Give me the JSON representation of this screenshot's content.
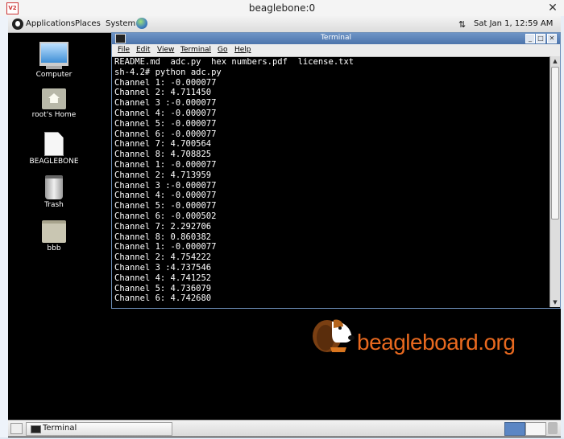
{
  "vnc": {
    "title": "beaglebone:0",
    "logo_text": "V2",
    "close_glyph": "✕"
  },
  "top_panel": {
    "applications": "Applications",
    "places": "Places",
    "system": "System",
    "network_glyph": "⇅",
    "clock": "Sat Jan  1, 12:59 AM"
  },
  "desktop_icons": [
    {
      "label": "Computer",
      "icon": "computer-icon"
    },
    {
      "label": "root's Home",
      "icon": "home-folder-icon"
    },
    {
      "label": "BEAGLEBONE",
      "icon": "file-icon"
    },
    {
      "label": "Trash",
      "icon": "trash-icon"
    },
    {
      "label": "bbb",
      "icon": "folder-icon"
    }
  ],
  "terminal": {
    "title": "Terminal",
    "buttons": {
      "minimize": "_",
      "maximize": "□",
      "close": "✕"
    },
    "menu": [
      "File",
      "Edit",
      "View",
      "Terminal",
      "Go",
      "Help"
    ],
    "lines": [
      "README.md  adc.py  hex numbers.pdf  license.txt",
      "sh-4.2# python adc.py",
      "Channel 1: -0.000077",
      "Channel 2: 4.711450",
      "Channel 3 :-0.000077",
      "Channel 4: -0.000077",
      "Channel 5: -0.000077",
      "Channel 6: -0.000077",
      "Channel 7: 4.700564",
      "Channel 8: 4.708825",
      "Channel 1: -0.000077",
      "Channel 2: 4.713959",
      "Channel 3 :-0.000077",
      "Channel 4: -0.000077",
      "Channel 5: -0.000077",
      "Channel 6: -0.000502",
      "Channel 7: 2.292706",
      "Channel 8: 0.860382",
      "Channel 1: -0.000077",
      "Channel 2: 4.754222",
      "Channel 3 :4.737546",
      "Channel 4: 4.741252",
      "Channel 5: 4.736079",
      "Channel 6: 4.742680"
    ],
    "scroll_up": "▲",
    "scroll_down": "▼"
  },
  "logo": {
    "text": "beagleboard.org",
    "color": "#e8691f"
  },
  "bottom_panel": {
    "task_label": "Terminal"
  }
}
